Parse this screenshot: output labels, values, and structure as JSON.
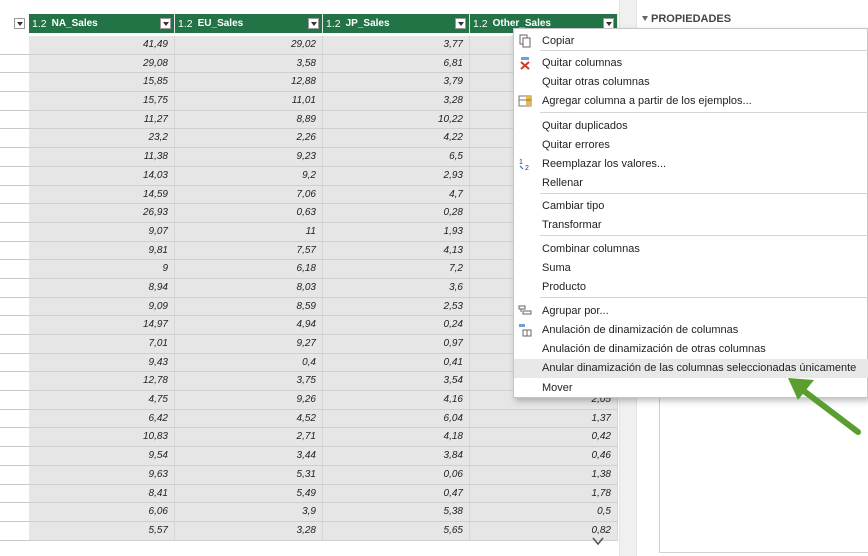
{
  "columns": [
    {
      "type": "1.2",
      "name": "NA_Sales"
    },
    {
      "type": "1.2",
      "name": "EU_Sales"
    },
    {
      "type": "1.2",
      "name": "JP_Sales"
    },
    {
      "type": "1.2",
      "name": "Other_Sales"
    }
  ],
  "rows": [
    [
      "41,49",
      "29,02",
      "3,77",
      ""
    ],
    [
      "29,08",
      "3,58",
      "6,81",
      ""
    ],
    [
      "15,85",
      "12,88",
      "3,79",
      ""
    ],
    [
      "15,75",
      "11,01",
      "3,28",
      ""
    ],
    [
      "11,27",
      "8,89",
      "10,22",
      ""
    ],
    [
      "23,2",
      "2,26",
      "4,22",
      ""
    ],
    [
      "11,38",
      "9,23",
      "6,5",
      ""
    ],
    [
      "14,03",
      "9,2",
      "2,93",
      ""
    ],
    [
      "14,59",
      "7,06",
      "4,7",
      ""
    ],
    [
      "26,93",
      "0,63",
      "0,28",
      ""
    ],
    [
      "9,07",
      "11",
      "1,93",
      ""
    ],
    [
      "9,81",
      "7,57",
      "4,13",
      ""
    ],
    [
      "9",
      "6,18",
      "7,2",
      ""
    ],
    [
      "8,94",
      "8,03",
      "3,6",
      ""
    ],
    [
      "9,09",
      "8,59",
      "2,53",
      ""
    ],
    [
      "14,97",
      "4,94",
      "0,24",
      ""
    ],
    [
      "7,01",
      "9,27",
      "0,97",
      ""
    ],
    [
      "9,43",
      "0,4",
      "0,41",
      ""
    ],
    [
      "12,78",
      "3,75",
      "3,54",
      ""
    ],
    [
      "4,75",
      "9,26",
      "4,16",
      "2,05"
    ],
    [
      "6,42",
      "4,52",
      "6,04",
      "1,37"
    ],
    [
      "10,83",
      "2,71",
      "4,18",
      "0,42"
    ],
    [
      "9,54",
      "3,44",
      "3,84",
      "0,46"
    ],
    [
      "9,63",
      "5,31",
      "0,06",
      "1,38"
    ],
    [
      "8,41",
      "5,49",
      "0,47",
      "1,78"
    ],
    [
      "6,06",
      "3,9",
      "5,38",
      "0,5"
    ],
    [
      "5,57",
      "3,28",
      "5,65",
      "0,82"
    ]
  ],
  "panel": {
    "title": "PROPIEDADES"
  },
  "menu": [
    {
      "label": "Copiar",
      "icon": "copy-icon"
    },
    {
      "label": "Quitar columnas",
      "icon": "remove-columns-icon"
    },
    {
      "label": "Quitar otras columnas",
      "icon": ""
    },
    {
      "label": "Agregar columna a partir de los ejemplos...",
      "icon": "column-from-examples-icon"
    },
    {
      "label": "Quitar duplicados",
      "icon": ""
    },
    {
      "label": "Quitar errores",
      "icon": ""
    },
    {
      "label": "Reemplazar los valores...",
      "icon": "replace-values-icon"
    },
    {
      "label": "Rellenar",
      "icon": ""
    },
    {
      "label": "Cambiar tipo",
      "icon": ""
    },
    {
      "label": "Transformar",
      "icon": ""
    },
    {
      "label": "Combinar columnas",
      "icon": ""
    },
    {
      "label": "Suma",
      "icon": ""
    },
    {
      "label": "Producto",
      "icon": ""
    },
    {
      "label": "Agrupar por...",
      "icon": "group-by-icon"
    },
    {
      "label": "Anulación de dinamización de columnas",
      "icon": "unpivot-icon"
    },
    {
      "label": "Anulación de dinamización de otras columnas",
      "icon": ""
    },
    {
      "label": "Anular dinamización de las columnas seleccionadas únicamente",
      "icon": ""
    },
    {
      "label": "Mover",
      "icon": ""
    }
  ],
  "menu_highlighted_index": 16,
  "colors": {
    "header": "#227447",
    "cell": "#e6e6e6",
    "arrow": "#5a9e2f"
  }
}
